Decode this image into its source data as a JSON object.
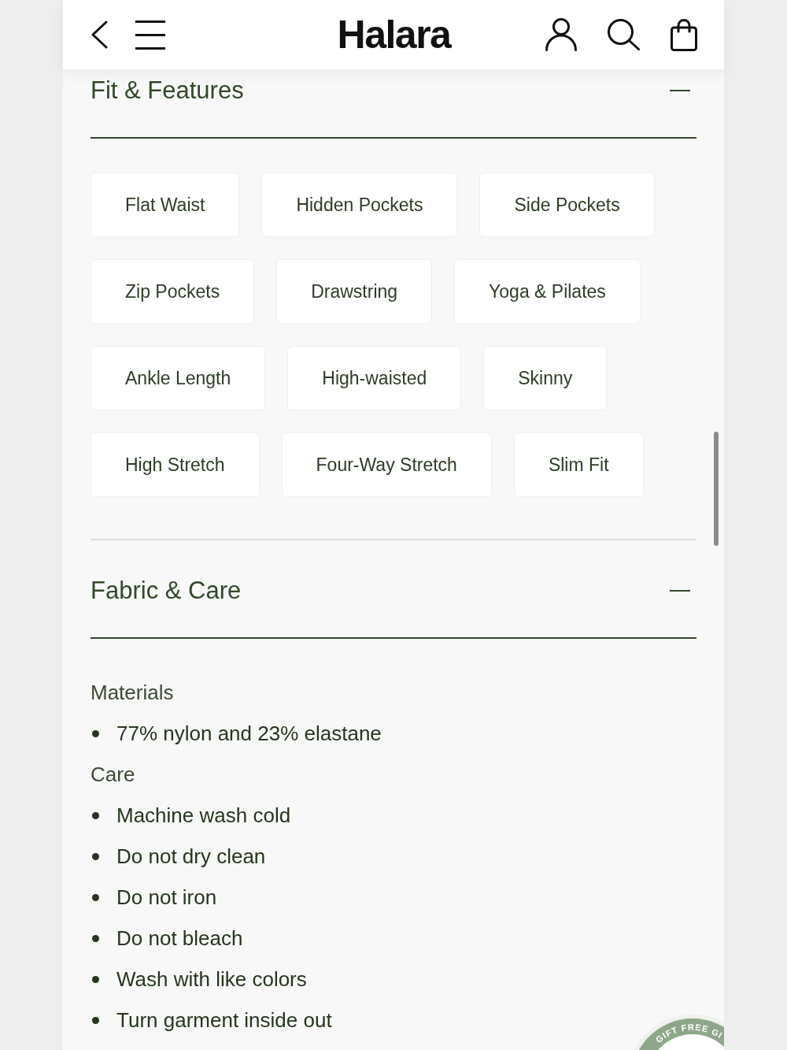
{
  "header": {
    "logo": "Halara"
  },
  "sections": [
    {
      "title": "Fit & Features",
      "expanded": true,
      "kind": "tags",
      "tags": [
        "Flat Waist",
        "Hidden Pockets",
        "Side Pockets",
        "Zip Pockets",
        "Drawstring",
        "Yoga & Pilates",
        "Ankle Length",
        "High-waisted",
        "Skinny",
        "High Stretch",
        "Four-Way Stretch",
        "Slim Fit"
      ]
    },
    {
      "title": "Fabric & Care",
      "expanded": true,
      "kind": "details",
      "groups": [
        {
          "label": "Materials",
          "items": [
            "77% nylon and 23% elastane"
          ]
        },
        {
          "label": "Care",
          "items": [
            "Machine wash cold",
            "Do not dry clean",
            "Do not iron",
            "Do not bleach",
            "Wash with like colors",
            "Turn garment inside out"
          ]
        }
      ]
    }
  ],
  "gift_badge": {
    "text": "GIFT FREE GI"
  }
}
